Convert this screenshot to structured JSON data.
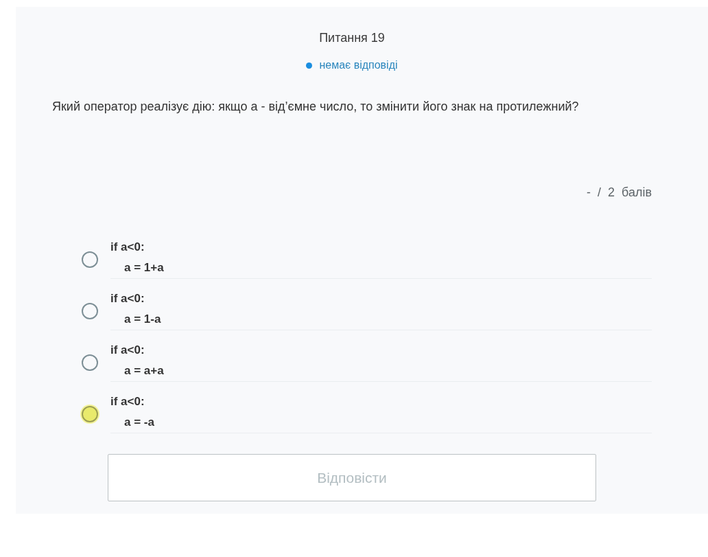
{
  "question": {
    "title": "Питання 19",
    "status": "немає відповіді",
    "text": "Який оператор реалізує дію: якщо a - від’ємне число, то змінити його знак на протилежний?",
    "score": "- / 2 балів"
  },
  "options": [
    {
      "lines": [
        "if a<0:",
        "a = 1+a"
      ],
      "selected": false,
      "highlighted": false
    },
    {
      "lines": [
        "if a<0:",
        "a = 1-a"
      ],
      "selected": false,
      "highlighted": false
    },
    {
      "lines": [
        "if a<0:",
        "a = a+a"
      ],
      "selected": false,
      "highlighted": false
    },
    {
      "lines": [
        "if a<0:",
        "a = -a"
      ],
      "selected": false,
      "highlighted": true
    }
  ],
  "answer_button": {
    "label": "Відповісти",
    "disabled": true
  }
}
